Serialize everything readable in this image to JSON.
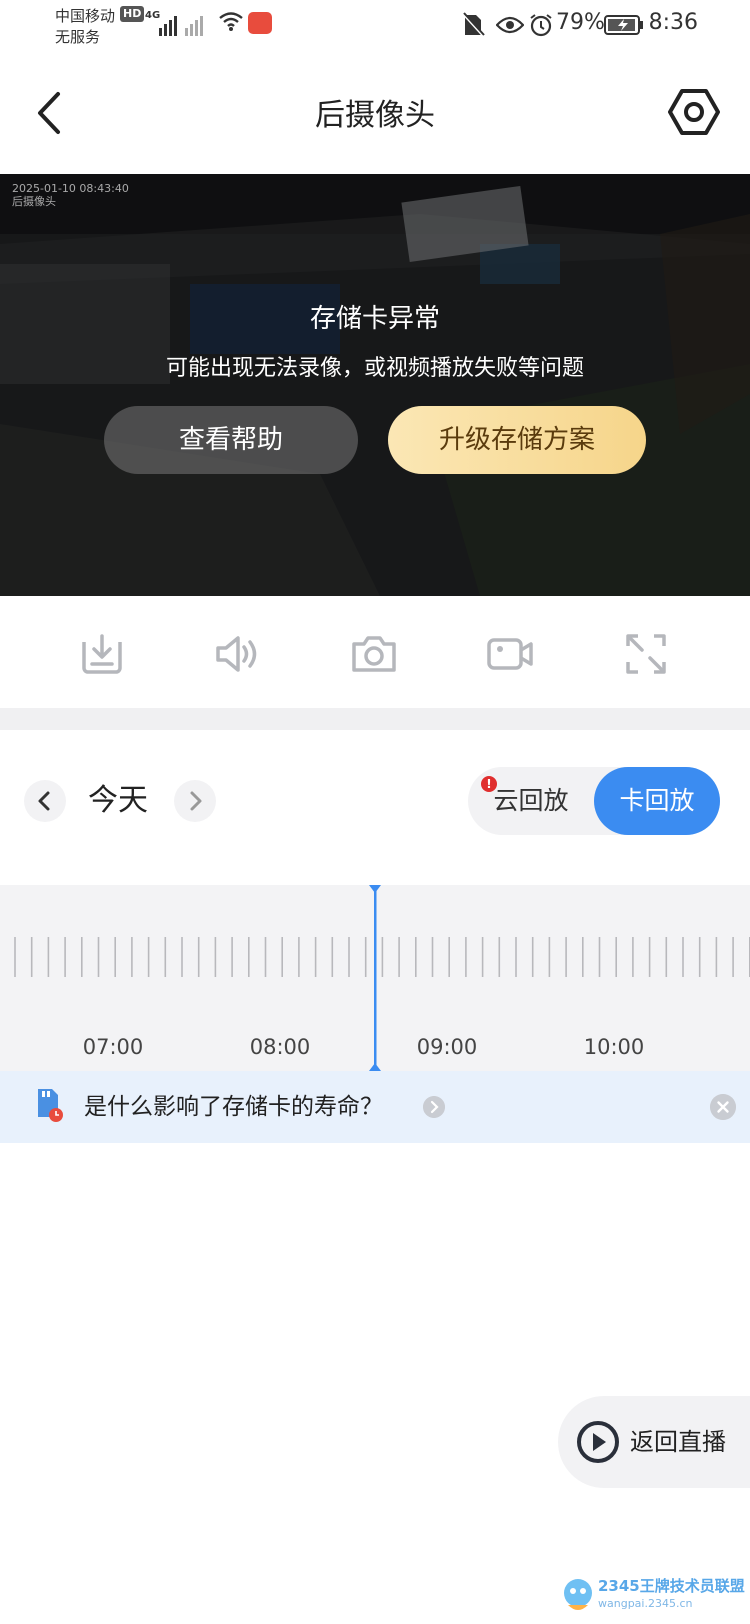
{
  "status_bar": {
    "carrier": "中国移动",
    "hd": "HD",
    "network": "4G",
    "service": "无服务",
    "battery": "79%",
    "time": "8:36"
  },
  "header": {
    "title": "后摄像头",
    "back_icon": "chevron-left-icon",
    "settings_icon": "hexagon-gear-icon"
  },
  "video": {
    "osd_line1": "2025-01-10 08:43:40",
    "osd_line2": "后摄像头",
    "error_title": "存储卡异常",
    "error_subtitle": "可能出现无法录像，或视频播放失败等问题",
    "help_button": "查看帮助",
    "upgrade_button": "升级存储方案"
  },
  "toolbar": {
    "items": [
      {
        "name": "download",
        "icon": "download-icon"
      },
      {
        "name": "sound",
        "icon": "speaker-icon"
      },
      {
        "name": "snapshot",
        "icon": "camera-icon"
      },
      {
        "name": "record",
        "icon": "video-record-icon"
      },
      {
        "name": "fullscreen",
        "icon": "fullscreen-icon"
      }
    ]
  },
  "date_nav": {
    "label": "今天",
    "prev_icon": "chevron-left-icon",
    "next_icon": "chevron-right-icon"
  },
  "playback_toggle": {
    "cloud": "云回放",
    "card": "卡回放",
    "selected": "卡回放",
    "alert_mark": "!"
  },
  "timeline": {
    "labels": [
      "07:00",
      "08:00",
      "09:00",
      "10:00"
    ]
  },
  "tip": {
    "text": "是什么影响了存储卡的寿命？",
    "icon": "sd-card-clock-icon"
  },
  "live_button": {
    "label": "返回直播",
    "icon": "play-circle-icon"
  },
  "watermark": {
    "text": "2345王牌技术员联盟",
    "sub": "wangpai.2345.cn"
  },
  "colors": {
    "accent": "#3b8cf1",
    "upgrade_gold": "#f6d58a",
    "tip_bg": "#e8f1fc"
  }
}
